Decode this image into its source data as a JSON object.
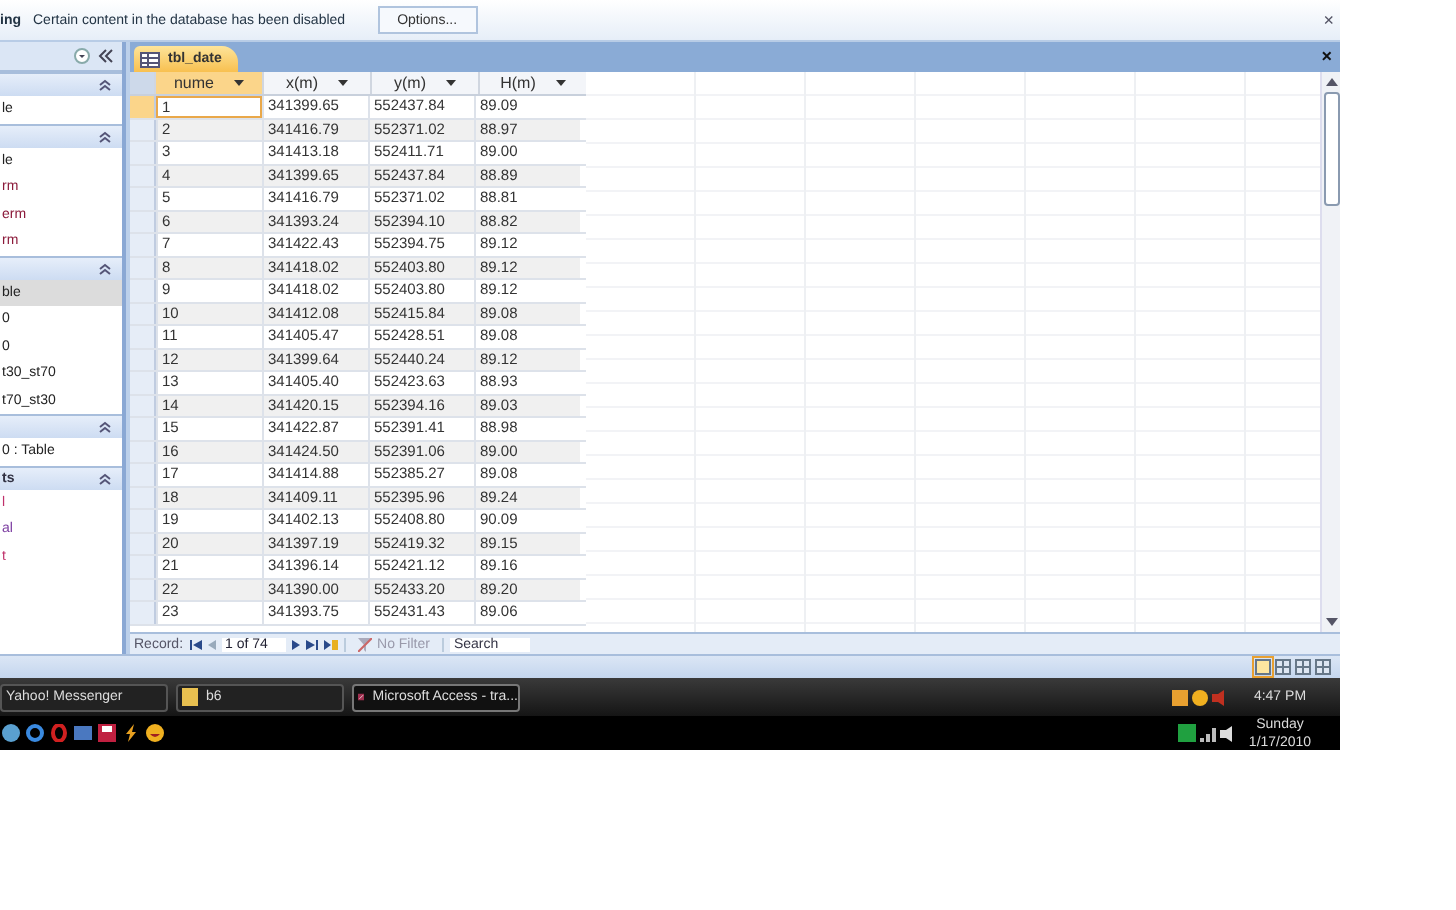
{
  "message_bar": {
    "title": "ing",
    "text": "Certain content in the database has been disabled",
    "button": "Options...",
    "close": "×"
  },
  "nav_pane": {
    "items": [
      {
        "kind": "header"
      },
      {
        "kind": "item",
        "label": "le",
        "selected": false
      },
      {
        "kind": "header"
      },
      {
        "kind": "item",
        "label": "le",
        "selected": false
      },
      {
        "kind": "item",
        "label": "rm",
        "selected": false,
        "color": "#8b1a3a"
      },
      {
        "kind": "item",
        "label": "erm",
        "selected": false,
        "color": "#8b1a3a"
      },
      {
        "kind": "item",
        "label": "rm",
        "selected": false,
        "color": "#8b1a3a"
      },
      {
        "kind": "header"
      },
      {
        "kind": "item",
        "label": "ble",
        "selected": true
      },
      {
        "kind": "item",
        "label": "0",
        "selected": false
      },
      {
        "kind": "item",
        "label": "0",
        "selected": false
      },
      {
        "kind": "item",
        "label": "t30_st70",
        "selected": false
      },
      {
        "kind": "item",
        "label": "t70_st30",
        "selected": false
      },
      {
        "kind": "header"
      },
      {
        "kind": "item",
        "label": "0 : Table",
        "selected": false
      },
      {
        "kind": "header",
        "label": "ts"
      },
      {
        "kind": "item",
        "label": "l",
        "selected": false,
        "color": "#c0306a"
      },
      {
        "kind": "item",
        "label": "al",
        "selected": false,
        "color": "#7a3aa0"
      },
      {
        "kind": "item",
        "label": "t",
        "selected": false,
        "color": "#c0306a"
      }
    ]
  },
  "document_tab": {
    "label": "tbl_date"
  },
  "table": {
    "columns": [
      "nume",
      "x(m)",
      "y(m)",
      "H(m)"
    ],
    "rows": [
      {
        "selected": true,
        "cells": [
          "1",
          "341399.65",
          "552437.84",
          "89.09"
        ]
      },
      {
        "selected": false,
        "cells": [
          "2",
          "341416.79",
          "552371.02",
          "88.97"
        ]
      },
      {
        "selected": false,
        "cells": [
          "3",
          "341413.18",
          "552411.71",
          "89.00"
        ]
      },
      {
        "selected": false,
        "cells": [
          "4",
          "341399.65",
          "552437.84",
          "88.89"
        ]
      },
      {
        "selected": false,
        "cells": [
          "5",
          "341416.79",
          "552371.02",
          "88.81"
        ]
      },
      {
        "selected": false,
        "cells": [
          "6",
          "341393.24",
          "552394.10",
          "88.82"
        ]
      },
      {
        "selected": false,
        "cells": [
          "7",
          "341422.43",
          "552394.75",
          "89.12"
        ]
      },
      {
        "selected": false,
        "cells": [
          "8",
          "341418.02",
          "552403.80",
          "89.12"
        ]
      },
      {
        "selected": false,
        "cells": [
          "9",
          "341418.02",
          "552403.80",
          "89.12"
        ]
      },
      {
        "selected": false,
        "cells": [
          "10",
          "341412.08",
          "552415.84",
          "89.08"
        ]
      },
      {
        "selected": false,
        "cells": [
          "11",
          "341405.47",
          "552428.51",
          "89.08"
        ]
      },
      {
        "selected": false,
        "cells": [
          "12",
          "341399.64",
          "552440.24",
          "89.12"
        ]
      },
      {
        "selected": false,
        "cells": [
          "13",
          "341405.40",
          "552423.63",
          "88.93"
        ]
      },
      {
        "selected": false,
        "cells": [
          "14",
          "341420.15",
          "552394.16",
          "89.03"
        ]
      },
      {
        "selected": false,
        "cells": [
          "15",
          "341422.87",
          "552391.41",
          "88.98"
        ]
      },
      {
        "selected": false,
        "cells": [
          "16",
          "341424.50",
          "552391.06",
          "89.00"
        ]
      },
      {
        "selected": false,
        "cells": [
          "17",
          "341414.88",
          "552385.27",
          "89.08"
        ]
      },
      {
        "selected": false,
        "cells": [
          "18",
          "341409.11",
          "552395.96",
          "89.24"
        ]
      },
      {
        "selected": false,
        "cells": [
          "19",
          "341402.13",
          "552408.80",
          "90.09"
        ]
      },
      {
        "selected": false,
        "cells": [
          "20",
          "341397.19",
          "552419.32",
          "89.15"
        ]
      },
      {
        "selected": false,
        "cells": [
          "21",
          "341396.14",
          "552421.12",
          "89.16"
        ]
      },
      {
        "selected": false,
        "cells": [
          "22",
          "341390.00",
          "552433.20",
          "89.20"
        ]
      },
      {
        "selected": false,
        "cells": [
          "23",
          "341393.75",
          "552431.43",
          "89.06"
        ]
      }
    ]
  },
  "record_nav": {
    "label": "Record:",
    "position": "1 of 74",
    "filter": "No Filter",
    "search": "Search"
  },
  "taskbar": {
    "buttons": [
      {
        "label": "Yahoo! Messenger",
        "selected": false
      },
      {
        "label": "b6",
        "selected": false
      },
      {
        "label": "Microsoft Access - tra...",
        "selected": true
      }
    ],
    "time": "4:47 PM",
    "day": "Sunday",
    "date": "1/17/2010"
  }
}
